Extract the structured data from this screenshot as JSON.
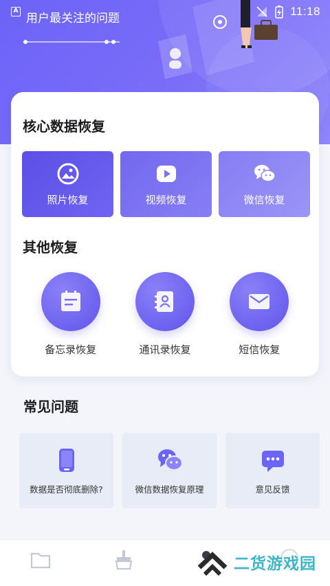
{
  "status_bar": {
    "app_badge": "A",
    "time": "11:18"
  },
  "hero": {
    "title": "用户最关注的问题"
  },
  "core": {
    "title": "核心数据恢复",
    "tiles": [
      {
        "label": "照片恢复",
        "icon": "photo-icon"
      },
      {
        "label": "视频恢复",
        "icon": "video-play-icon"
      },
      {
        "label": "微信恢复",
        "icon": "wechat-icon"
      }
    ]
  },
  "other": {
    "title": "其他恢复",
    "items": [
      {
        "label": "备忘录恢复",
        "icon": "notes-icon"
      },
      {
        "label": "通讯录恢复",
        "icon": "contacts-icon"
      },
      {
        "label": "短信恢复",
        "icon": "message-envelope-icon"
      }
    ]
  },
  "faq": {
    "title": "常见问题",
    "items": [
      {
        "label": "数据是否彻底删除?",
        "icon": "phone-icon"
      },
      {
        "label": "微信数据恢复原理",
        "icon": "wechat-icon"
      },
      {
        "label": "意见反馈",
        "icon": "feedback-chat-icon"
      }
    ]
  },
  "bottom_nav": {
    "items": [
      "folder-icon",
      "clean-brush-icon",
      "recovery-icon",
      "profile-icon"
    ]
  },
  "watermark": {
    "text": "二货游戏园"
  },
  "colors": {
    "primary": "#6c63f7",
    "card_bg": "#ffffff",
    "faq_bg": "#e8ecf6",
    "watermark": "#3fb5c8"
  }
}
